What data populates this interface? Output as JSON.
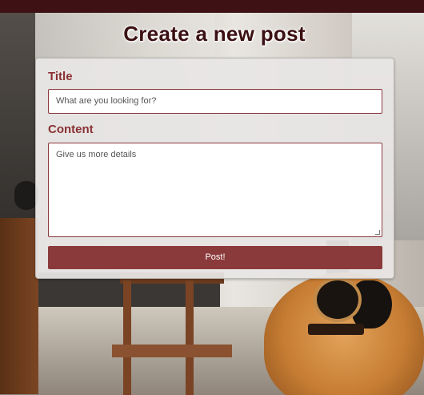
{
  "page": {
    "title": "Create a new post"
  },
  "form": {
    "title_label": "Title",
    "title_placeholder": "What are you looking for?",
    "content_label": "Content",
    "content_placeholder": "Give us more details",
    "submit_label": "Post!"
  },
  "colors": {
    "topbar": "#3e1214",
    "accent": "#8b3a3b",
    "label": "#8a3034",
    "title_text": "#3b1012"
  }
}
